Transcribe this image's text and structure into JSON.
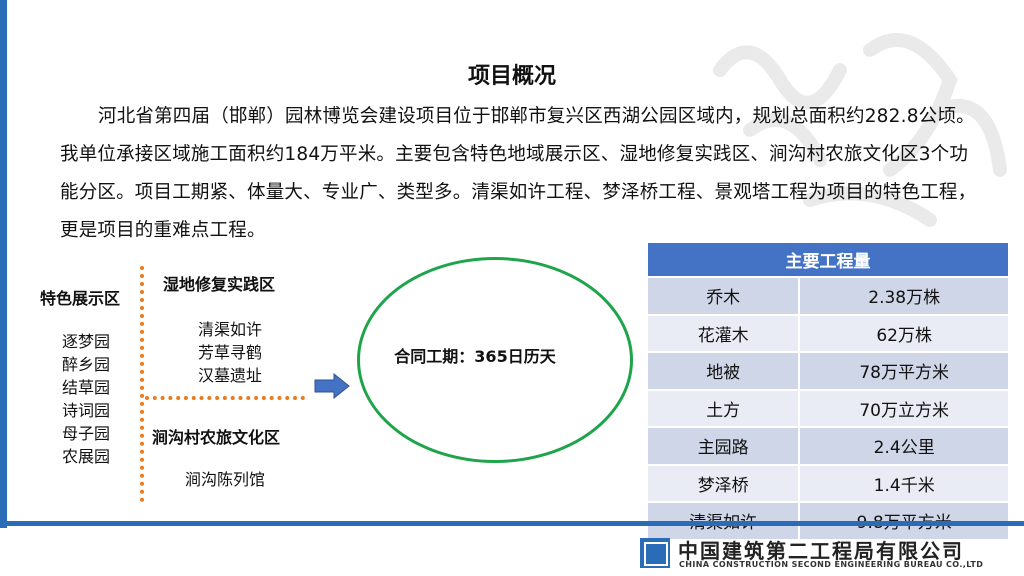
{
  "title": "项目概况",
  "paragraph": "河北省第四届（邯郸）园林博览会建设项目位于邯郸市复兴区西湖公园区域内，规划总面积约282.8公顷。我单位承接区域施工面积约184万平米。主要包含特色地域展示区、湿地修复实践区、涧沟村农旅文化区3个功能分区。项目工期紧、体量大、专业广、类型多。清渠如许工程、梦泽桥工程、景观塔工程为项目的特色工程，更是项目的重难点工程。",
  "zones": {
    "feature": {
      "label": "特色展示区",
      "items": [
        "逐梦园",
        "醉乡园",
        "结草园",
        "诗词园",
        "母子园",
        "农展园"
      ]
    },
    "wetland": {
      "label": "湿地修复实践区",
      "items": [
        "清渠如许",
        "芳草寻鹤",
        "汉墓遗址"
      ]
    },
    "village": {
      "label": "涧沟村农旅文化区",
      "items": [
        "涧沟陈列馆"
      ]
    }
  },
  "contract": "合同工期：365日历天",
  "quantities": {
    "header": "主要工程量",
    "rows": [
      [
        "乔木",
        "2.38万株"
      ],
      [
        "花灌木",
        "62万株"
      ],
      [
        "地被",
        "78万平方米"
      ],
      [
        "土方",
        "70万立方米"
      ],
      [
        "主园路",
        "2.4公里"
      ],
      [
        "梦泽桥",
        "1.4千米"
      ],
      [
        "清渠如许",
        "9.8万平方米"
      ]
    ]
  },
  "company": {
    "cn": "中国建筑第二工程局有限公司",
    "en": "CHINA CONSTRUCTION SECOND ENGINEERING BUREAU CO.,LTD"
  },
  "colors": {
    "accent": "#2b6cb8",
    "dotted": "#ec7a1c",
    "ellipse": "#1ea44a",
    "table_head": "#4472c4"
  }
}
